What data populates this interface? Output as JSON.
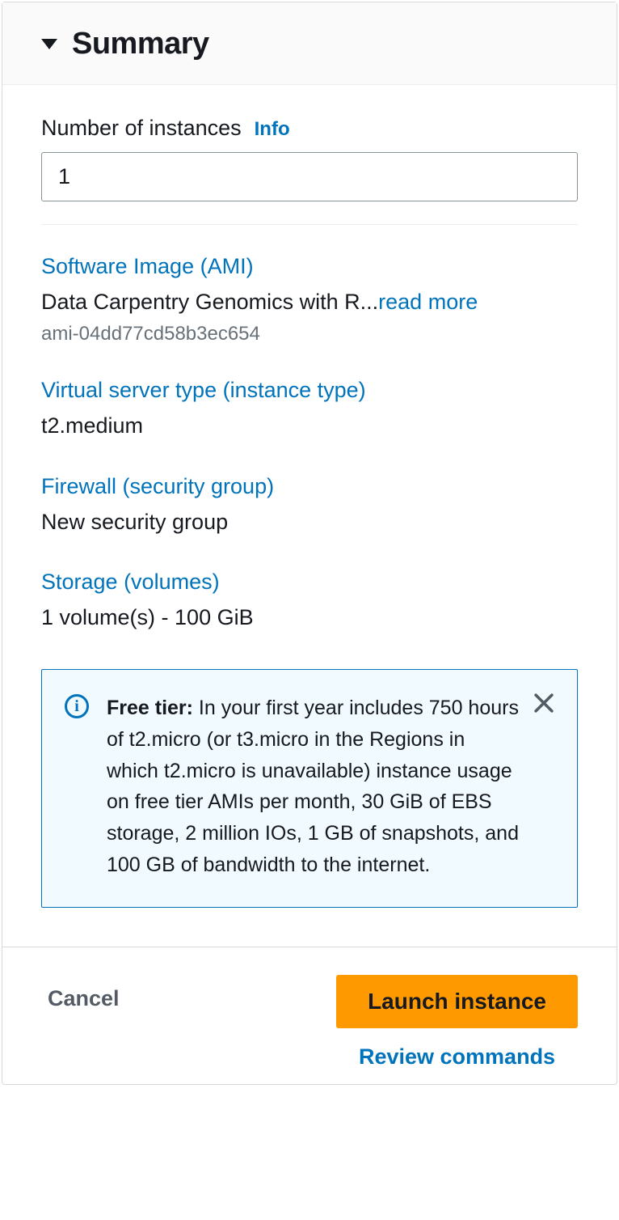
{
  "header": {
    "title": "Summary"
  },
  "instances": {
    "label": "Number of instances",
    "info": "Info",
    "value": "1"
  },
  "ami": {
    "heading": "Software Image (AMI)",
    "name": "Data Carpentry Genomics with R...",
    "read_more": "read more",
    "id": "ami-04dd77cd58b3ec654"
  },
  "instance_type": {
    "heading": "Virtual server type (instance type)",
    "value": "t2.medium"
  },
  "firewall": {
    "heading": "Firewall (security group)",
    "value": "New security group"
  },
  "storage": {
    "heading": "Storage (volumes)",
    "value": "1 volume(s) - 100 GiB"
  },
  "free_tier": {
    "label": "Free tier:",
    "text": " In your first year includes 750 hours of t2.micro (or t3.micro in the Regions in which t2.micro is unavailable) instance usage on free tier AMIs per month, 30 GiB of EBS storage, 2 million IOs, 1 GB of snapshots, and 100 GB of bandwidth to the internet."
  },
  "footer": {
    "cancel": "Cancel",
    "launch": "Launch instance",
    "review": "Review commands"
  }
}
